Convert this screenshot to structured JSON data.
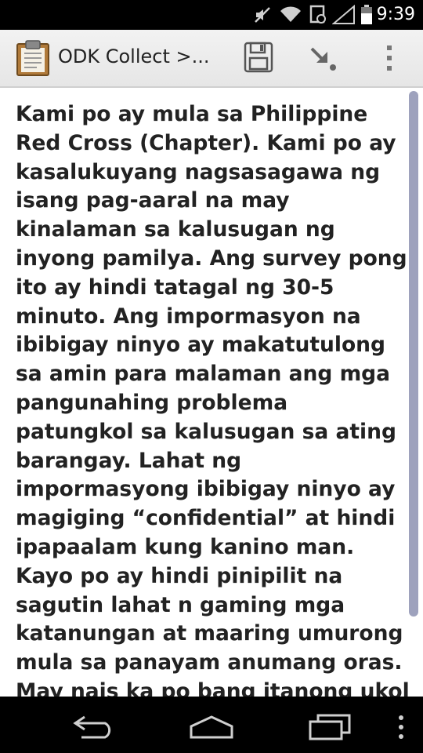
{
  "status_bar": {
    "time": "9:39",
    "icons": [
      "mute-icon",
      "wifi-icon",
      "sync-icon",
      "signal-icon",
      "battery-icon"
    ]
  },
  "action_bar": {
    "title": "ODK Collect >...",
    "buttons": [
      "save-icon",
      "forward-icon",
      "overflow-menu-icon"
    ]
  },
  "question": {
    "text": "Kami po ay mula sa Philippine Red Cross (Chapter). Kami po ay kasalukuyang nagsasagawa ng isang pag-aaral na may kinalaman sa kalusugan ng inyong pamilya. Ang survey pong ito ay hindi tatagal ng 30-5 minuto. Ang impormasyon na ibibigay ninyo ay makatutulong sa amin para malaman ang mga pangunahing problema patungkol sa kalusugan sa ating barangay. Lahat ng impormasyong ibibigay ninyo ay magiging “confidential” at hindi ipapaalam kung kanino man. Kayo po ay hindi pinipilit na sagutin lahat n gaming mga katanungan at maaring umurong mula sa panayam anumang oras. May nais ka po bang itanong ukol sa survey pong ito?"
  },
  "nav_bar": {
    "buttons": [
      "back-icon",
      "home-icon",
      "recents-icon",
      "menu-icon"
    ]
  },
  "colors": {
    "status_bar": "#000000",
    "action_bar": "#ececec",
    "text": "#222222",
    "scrollbar": "#9ea2bd"
  }
}
